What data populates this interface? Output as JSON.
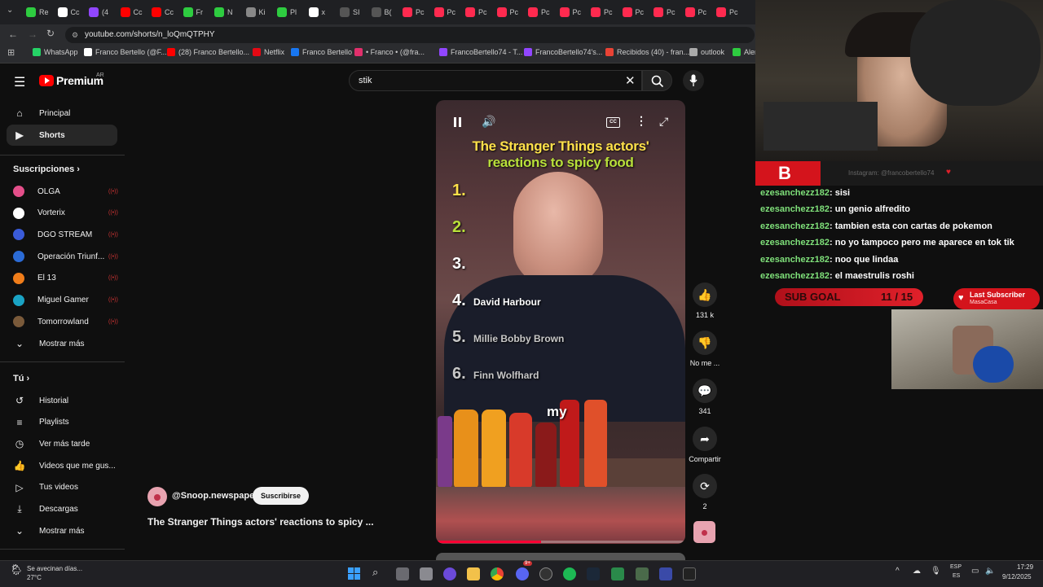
{
  "browser": {
    "tabs": [
      {
        "label": "Re",
        "color": "#2ecc40"
      },
      {
        "label": "Cc",
        "color": "#ffffff"
      },
      {
        "label": "(4",
        "color": "#9146ff"
      },
      {
        "label": "Cc",
        "color": "#ff0000"
      },
      {
        "label": "Cc",
        "color": "#ff0000"
      },
      {
        "label": "Fr",
        "color": "#2ecc40"
      },
      {
        "label": "N",
        "color": "#2ecc40"
      },
      {
        "label": "Ki",
        "color": "#888888"
      },
      {
        "label": "Pl",
        "color": "#2ecc40"
      },
      {
        "label": "x",
        "color": "#ffffff"
      },
      {
        "label": "SI",
        "color": "#555555"
      },
      {
        "label": "B(",
        "color": "#555555"
      },
      {
        "label": "Pc",
        "color": "#ff2a4f"
      },
      {
        "label": "Pc",
        "color": "#ff2a4f"
      },
      {
        "label": "Pc",
        "color": "#ff2a4f"
      },
      {
        "label": "Pc",
        "color": "#ff2a4f"
      },
      {
        "label": "Pc",
        "color": "#ff2a4f"
      },
      {
        "label": "Pc",
        "color": "#ff2a4f"
      },
      {
        "label": "Pc",
        "color": "#ff2a4f"
      },
      {
        "label": "Pc",
        "color": "#ff2a4f"
      },
      {
        "label": "Pc",
        "color": "#ff2a4f"
      },
      {
        "label": "Pc",
        "color": "#ff2a4f"
      },
      {
        "label": "Pc",
        "color": "#ff2a4f"
      }
    ],
    "url": "youtube.com/shorts/n_loQmQTPHY",
    "bookmarks": [
      {
        "label": "WhatsApp",
        "color": "#25d366"
      },
      {
        "label": "Franco Bertello (@F...",
        "color": "#ffffff"
      },
      {
        "label": "(28) Franco Bertello...",
        "color": "#ff0000"
      },
      {
        "label": "Netflix",
        "color": "#e50914"
      },
      {
        "label": "Franco Bertello",
        "color": "#1877f2"
      },
      {
        "label": "• Franco • (@fra...",
        "color": "#e1306c"
      },
      {
        "label": "FrancoBertello74 - T...",
        "color": "#9146ff"
      },
      {
        "label": "FrancoBertello74's...",
        "color": "#9146ff"
      },
      {
        "label": "Recibidos (40) - fran...",
        "color": "#ea4335"
      },
      {
        "label": "outlook",
        "color": "#aaaaaa"
      },
      {
        "label": "Aler",
        "color": "#2ecc40"
      }
    ]
  },
  "youtube": {
    "logo": "Premium",
    "region": "AR",
    "search_value": "stik",
    "nav": [
      {
        "label": "Principal",
        "icon": "home-icon",
        "glyph": "⌂"
      },
      {
        "label": "Shorts",
        "icon": "shorts-icon",
        "glyph": "▶"
      }
    ],
    "subs_title": "Suscripciones",
    "subs": [
      {
        "label": "OLGA",
        "color": "#e44f8a"
      },
      {
        "label": "Vorterix",
        "color": "#ffffff"
      },
      {
        "label": "DGO STREAM",
        "color": "#3a5bd9"
      },
      {
        "label": "Operación Triunf...",
        "color": "#2b6bd6"
      },
      {
        "label": "El 13",
        "color": "#f07d1a"
      },
      {
        "label": "Miguel Gamer",
        "color": "#1aa3c4"
      },
      {
        "label": "Tomorrowland",
        "color": "#7a5a3a"
      }
    ],
    "show_more": "Mostrar más",
    "you_title": "Tú",
    "you_items": [
      {
        "label": "Historial",
        "glyph": "↺"
      },
      {
        "label": "Playlists",
        "glyph": "≡"
      },
      {
        "label": "Ver más tarde",
        "glyph": "◷"
      },
      {
        "label": "Videos que me gus...",
        "glyph": "👍"
      },
      {
        "label": "Tus videos",
        "glyph": "▷"
      },
      {
        "label": "Descargas",
        "glyph": "⤓"
      }
    ],
    "show_more_2": "Mostrar más",
    "video": {
      "title_line1": "The Stranger Things actors'",
      "title_line2": "reactions to spicy food",
      "ranks": [
        {
          "n": "1.",
          "name": "",
          "color": "#ffe14a"
        },
        {
          "n": "2.",
          "name": "",
          "color": "#b8e03a"
        },
        {
          "n": "3.",
          "name": "",
          "color": "#ffffff"
        },
        {
          "n": "4.",
          "name": "David Harbour",
          "color": "#ffffff"
        },
        {
          "n": "5.",
          "name": "Millie Bobby Brown",
          "color": "#c8c8c8"
        },
        {
          "n": "6.",
          "name": "Finn Wolfhard",
          "color": "#c8c8c8"
        }
      ],
      "caption": "my",
      "progress": 0.42
    },
    "channel": "@Snoop.newspaper",
    "subscribe": "Suscribirse",
    "video_title": "The Stranger Things actors' reactions to spicy ...",
    "actions": {
      "likes": "131 k",
      "dislike": "No me ...",
      "comments": "341",
      "share": "Compartir",
      "remix": "2"
    }
  },
  "stream": {
    "instagram": "Instagram: @francobertello74",
    "chat": [
      {
        "user": "ezesanchezz182",
        "msg": ": sisi"
      },
      {
        "user": "ezesanchezz182",
        "msg": ": un genio alfredito"
      },
      {
        "user": "ezesanchezz182",
        "msg": ": tambien esta con cartas de pokemon"
      },
      {
        "user": "ezesanchezz182",
        "msg": ": no yo tampoco pero me aparece en tok tik"
      },
      {
        "user": "ezesanchezz182",
        "msg": ": noo que lindaa"
      },
      {
        "user": "ezesanchezz182",
        "msg": ": el maestrulis roshi"
      }
    ],
    "sub_goal_label": "SUB GOAL",
    "sub_goal_current": "11",
    "sub_goal_total": "15",
    "sub_goal_fraction": 0.733,
    "last_sub_label": "Last Subscriber",
    "last_sub_name": "MasaCasa"
  },
  "taskbar": {
    "weather_title": "Se avecinan días...",
    "weather_temp": "27°C",
    "lang1": "ESP",
    "lang2": "ES",
    "time": "17:29",
    "date": "9/12/2025",
    "badge": "9+"
  }
}
